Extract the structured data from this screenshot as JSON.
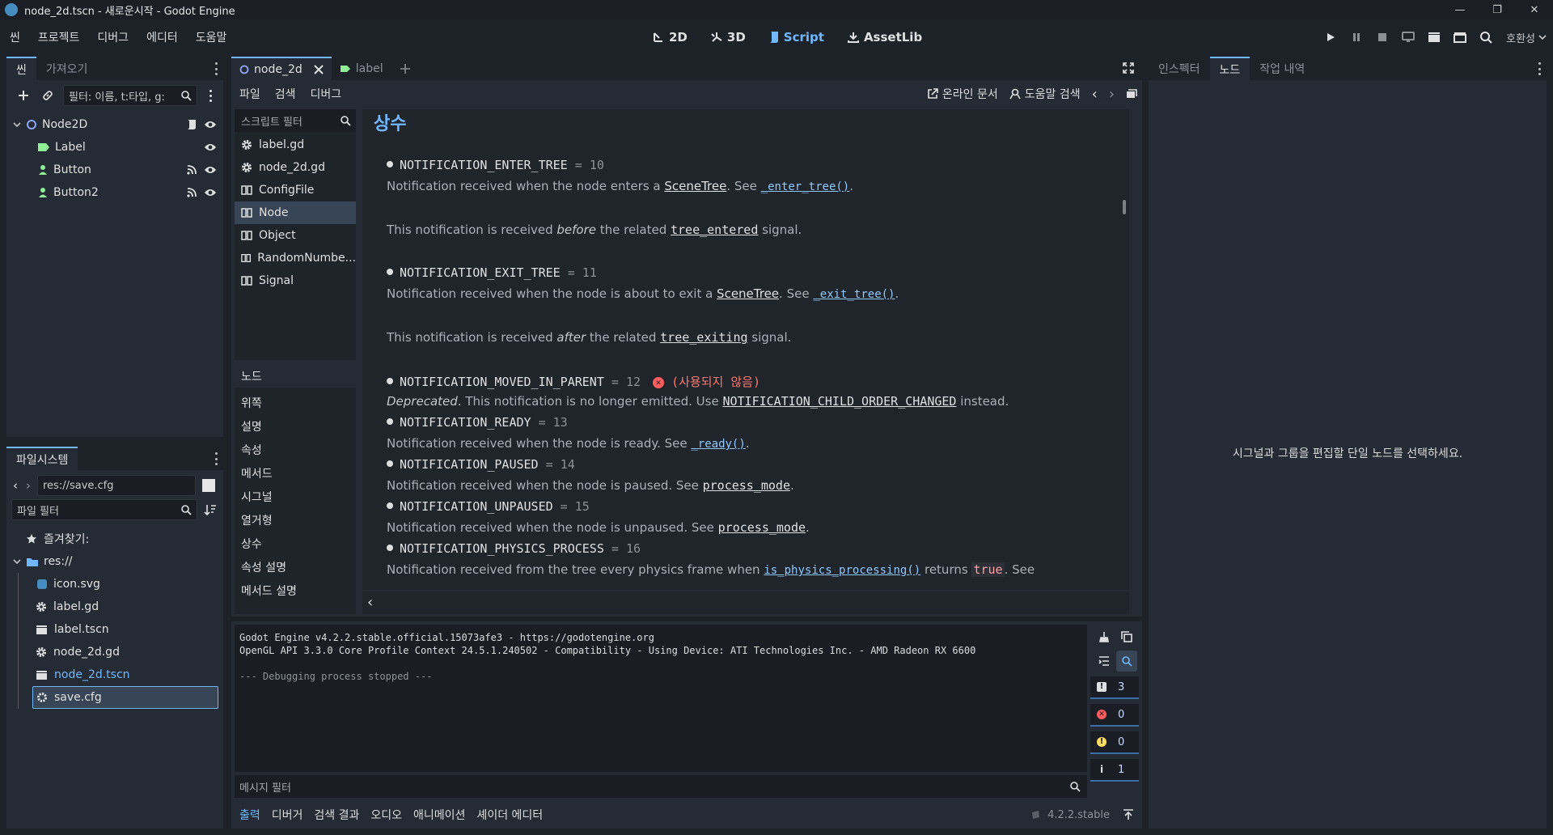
{
  "window": {
    "title": "node_2d.tscn - 새로운시작 - Godot Engine",
    "controls": [
      "—",
      "❐",
      "✕"
    ]
  },
  "menu": [
    "씬",
    "프로젝트",
    "디버그",
    "에디터",
    "도움말"
  ],
  "workspaces": [
    {
      "label": "2D",
      "icon": "2d-icon"
    },
    {
      "label": "3D",
      "icon": "3d-icon"
    },
    {
      "label": "Script",
      "icon": "script-icon",
      "active": true
    },
    {
      "label": "AssetLib",
      "icon": "assetlib-icon"
    }
  ],
  "renderer": "호환성",
  "scene_dock": {
    "tabs": [
      "씬",
      "가져오기"
    ],
    "filter_placeholder": "필터: 이름, t:타입, g:",
    "nodes": [
      {
        "name": "Node2D",
        "icon": "node2d-icon",
        "depth": 0
      },
      {
        "name": "Label",
        "icon": "label-icon",
        "depth": 1
      },
      {
        "name": "Button",
        "icon": "button-icon",
        "depth": 1
      },
      {
        "name": "Button2",
        "icon": "button-icon",
        "depth": 1
      }
    ]
  },
  "filesystem": {
    "tab": "파일시스템",
    "path": "res://save.cfg",
    "filter_placeholder": "파일 필터",
    "favorites": "즐겨찾기:",
    "root": "res://",
    "files": [
      {
        "name": "icon.svg",
        "icon": "svg-icon"
      },
      {
        "name": "label.gd",
        "icon": "gear-icon"
      },
      {
        "name": "label.tscn",
        "icon": "clapper-icon"
      },
      {
        "name": "node_2d.gd",
        "icon": "gear-icon"
      },
      {
        "name": "node_2d.tscn",
        "icon": "clapper-icon",
        "highlight": true
      },
      {
        "name": "save.cfg",
        "icon": "config-icon",
        "selected": true
      }
    ]
  },
  "editor_tabs": [
    {
      "label": "node_2d",
      "active": true
    },
    {
      "label": "label",
      "active": false
    }
  ],
  "script_menu": [
    "파일",
    "검색",
    "디버그"
  ],
  "script_toolbar": {
    "online_docs": "온라인 문서",
    "help_search": "도움말 검색"
  },
  "script_filter_placeholder": "스크립트 필터",
  "scripts": [
    {
      "name": "label.gd",
      "icon": "gear-icon"
    },
    {
      "name": "node_2d.gd",
      "icon": "gear-icon"
    },
    {
      "name": "ConfigFile",
      "icon": "doc-icon"
    },
    {
      "name": "Node",
      "icon": "doc-icon",
      "selected": true
    },
    {
      "name": "Object",
      "icon": "doc-icon"
    },
    {
      "name": "RandomNumbe...",
      "icon": "doc-icon"
    },
    {
      "name": "Signal",
      "icon": "doc-icon"
    }
  ],
  "members": {
    "header": "노드",
    "items": [
      "위쪽",
      "설명",
      "속성",
      "메서드",
      "시그널",
      "열거형",
      "상수",
      "속성 설명",
      "메서드 설명"
    ]
  },
  "doc": {
    "heading": "상수",
    "constants": [
      {
        "name": "NOTIFICATION_ENTER_TREE",
        "value": "10"
      },
      {
        "name": "NOTIFICATION_EXIT_TREE",
        "value": "11"
      },
      {
        "name": "NOTIFICATION_MOVED_IN_PARENT",
        "value": "12",
        "deprecated": "(사용되지 않음)"
      },
      {
        "name": "NOTIFICATION_READY",
        "value": "13"
      },
      {
        "name": "NOTIFICATION_PAUSED",
        "value": "14"
      },
      {
        "name": "NOTIFICATION_UNPAUSED",
        "value": "15"
      },
      {
        "name": "NOTIFICATION_PHYSICS_PROCESS",
        "value": "16"
      }
    ],
    "texts": {
      "enter_a": "Notification received when the node enters a ",
      "scenetree": "SceneTree",
      "see": ". See ",
      "enter_fn": "_enter_tree()",
      "dot": ".",
      "enter_b1": "This notification is received ",
      "before": "before",
      "enter_b2": " the related ",
      "tree_entered": "tree_entered",
      "signal": " signal.",
      "exit_a": "Notification received when the node is about to exit a ",
      "exit_fn": "_exit_tree()",
      "exit_b1": "This notification is received ",
      "after": "after",
      "exit_b2": " the related ",
      "tree_exiting": "tree_exiting",
      "moved_dep": "Deprecated",
      "moved_a": ". This notification is no longer emitted. Use ",
      "moved_ref": "NOTIFICATION_CHILD_ORDER_CHANGED",
      "moved_b": " instead.",
      "ready_a": "Notification received when the node is ready. See ",
      "ready_fn": "_ready()",
      "paused_a": "Notification received when the node is paused. See ",
      "process_mode": "process_mode",
      "unpaused_a": "Notification received when the node is unpaused. See ",
      "phys_a": "Notification received from the tree every physics frame when ",
      "phys_fn": "is_physics_processing()",
      "returns": " returns ",
      "true": "true",
      "see_end": ". See"
    }
  },
  "output": {
    "lines": [
      "Godot Engine v4.2.2.stable.official.15073afe3 - https://godotengine.org",
      "OpenGL API 3.3.0 Core Profile Context 24.5.1.240502 - Compatibility - Using Device: ATI Technologies Inc. - AMD Radeon RX 6600",
      "--- Debugging process stopped ---"
    ],
    "counts": {
      "messages": "3",
      "errors": "0",
      "warnings": "0",
      "info": "1"
    },
    "filter_placeholder": "메시지 필터"
  },
  "bottom_tabs": [
    "출력",
    "디버거",
    "검색 결과",
    "오디오",
    "애니메이션",
    "셰이더 에디터"
  ],
  "version": "4.2.2.stable",
  "right_dock": {
    "tabs": [
      "인스펙터",
      "노드",
      "작업 내역"
    ],
    "message": "시그널과 그룹을 편집할 단일 노드를 선택하세요."
  },
  "colors": {
    "accent": "#70b7ff",
    "error": "#ff5d5d",
    "warning": "#ffdd65"
  }
}
